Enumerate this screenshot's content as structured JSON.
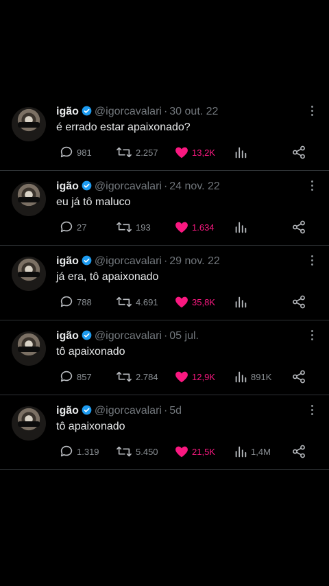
{
  "tweets": [
    {
      "name": "igão",
      "handle": "@igorcavalari",
      "date": "30 out. 22",
      "text": "é errado estar apaixonado?",
      "replies": "981",
      "retweets": "2.257",
      "likes": "13,2K",
      "views": ""
    },
    {
      "name": "igão",
      "handle": "@igorcavalari",
      "date": "24 nov. 22",
      "text": "eu já tô maluco",
      "replies": "27",
      "retweets": "193",
      "likes": "1.634",
      "views": ""
    },
    {
      "name": "igão",
      "handle": "@igorcavalari",
      "date": "29 nov. 22",
      "text": "já era, tô apaixonado",
      "replies": "788",
      "retweets": "4.691",
      "likes": "35,8K",
      "views": ""
    },
    {
      "name": "igão",
      "handle": "@igorcavalari",
      "date": "05 jul.",
      "text": "tô apaixonado",
      "replies": "857",
      "retweets": "2.784",
      "likes": "12,9K",
      "views": "891K"
    },
    {
      "name": "igão",
      "handle": "@igorcavalari",
      "date": "5d",
      "text": "tô apaixonado",
      "replies": "1.319",
      "retweets": "5.450",
      "likes": "21,5K",
      "views": "1,4M"
    }
  ],
  "colors": {
    "background": "#000000",
    "text": "#e7e9ea",
    "secondary": "#71767b",
    "like": "#f91880",
    "verified": "#1d9bf0"
  },
  "icons": [
    "verified-badge-icon",
    "more-vertical-icon",
    "reply-icon",
    "retweet-icon",
    "heart-icon",
    "views-icon",
    "share-icon"
  ]
}
